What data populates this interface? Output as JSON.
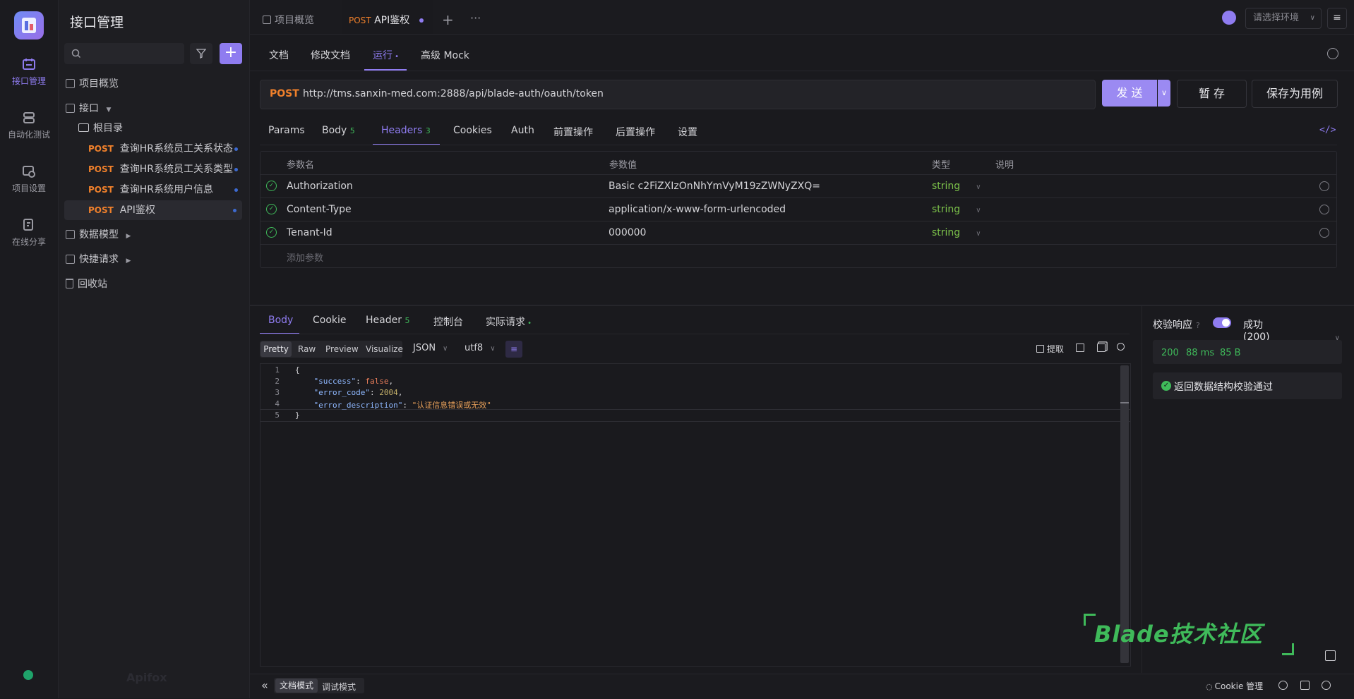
{
  "sidebar_rail": {
    "items": [
      {
        "label": "接口管理",
        "icon": "api-icon"
      },
      {
        "label": "自动化测试",
        "icon": "automation-icon"
      },
      {
        "label": "项目设置",
        "icon": "settings-icon"
      },
      {
        "label": "在线分享",
        "icon": "share-icon"
      }
    ],
    "watermark": "Apifox"
  },
  "tree": {
    "title": "接口管理",
    "overview": "项目概览",
    "api_group": "接口",
    "root": "根目录",
    "items": [
      {
        "method": "POST",
        "name": "查询HR系统员工关系状态"
      },
      {
        "method": "POST",
        "name": "查询HR系统员工关系类型"
      },
      {
        "method": "POST",
        "name": "查询HR系统用户信息"
      },
      {
        "method": "POST",
        "name": "API鉴权"
      }
    ],
    "data_model": "数据模型",
    "quick_request": "快捷请求",
    "recycle": "回收站"
  },
  "top_tabs": {
    "overview": "项目概览",
    "active_method": "POST",
    "active_name": "API鉴权",
    "env_placeholder": "请选择环境"
  },
  "doc_tabs": [
    "文档",
    "修改文档",
    "运行",
    "高级 Mock"
  ],
  "request": {
    "method": "POST",
    "url": "http://tms.sanxin-med.com:2888/api/blade-auth/oauth/token",
    "send": "发 送",
    "save": "暂 存",
    "save_case": "保存为用例"
  },
  "req_tabs": {
    "params": "Params",
    "body": "Body",
    "body_count": "5",
    "headers": "Headers",
    "headers_count": "3",
    "cookies": "Cookies",
    "auth": "Auth",
    "pre": "前置操作",
    "post": "后置操作",
    "settings": "设置"
  },
  "headers_table": {
    "columns": [
      "参数名",
      "参数值",
      "类型",
      "说明"
    ],
    "rows": [
      {
        "name": "Authorization",
        "value": "Basic c2FiZXIzOnNhYmVyM19zZWNyZXQ=",
        "type": "string"
      },
      {
        "name": "Content-Type",
        "value": "application/x-www-form-urlencoded",
        "type": "string"
      },
      {
        "name": "Tenant-Id",
        "value": "000000",
        "type": "string"
      }
    ],
    "add_placeholder": "添加参数"
  },
  "resp_tabs": {
    "body": "Body",
    "cookie": "Cookie",
    "header": "Header",
    "header_count": "5",
    "console": "控制台",
    "actual": "实际请求"
  },
  "resp_view": {
    "modes": [
      "Pretty",
      "Raw",
      "Preview",
      "Visualize"
    ],
    "format": "JSON",
    "encoding": "utf8",
    "extract": "提取"
  },
  "response_code": [
    {
      "n": "1",
      "text": "{"
    },
    {
      "n": "2",
      "key": "\"success\"",
      "val": "false",
      "kind": "bool",
      "comma": true
    },
    {
      "n": "3",
      "key": "\"error_code\"",
      "val": "2004",
      "kind": "num",
      "comma": true
    },
    {
      "n": "4",
      "key": "\"error_description\"",
      "val": "\"认证信息错误或无效\"",
      "kind": "str",
      "comma": false
    },
    {
      "n": "5",
      "text": "}"
    }
  ],
  "validation": {
    "label": "校验响应",
    "status": "成功 (200)",
    "code": "200",
    "time": "88 ms",
    "size": "85 B",
    "message": "返回数据结构校验通过"
  },
  "watermark_text": "Blade技术社区",
  "bottom_bar": {
    "doc_mode": "文档模式",
    "debug_mode": "调试模式",
    "cookie_mgr": "Cookie 管理"
  },
  "colors": {
    "accent": "#8f7cf0",
    "post": "#f0802b",
    "success": "#3fba5a",
    "watermark": "#3fba5a"
  }
}
